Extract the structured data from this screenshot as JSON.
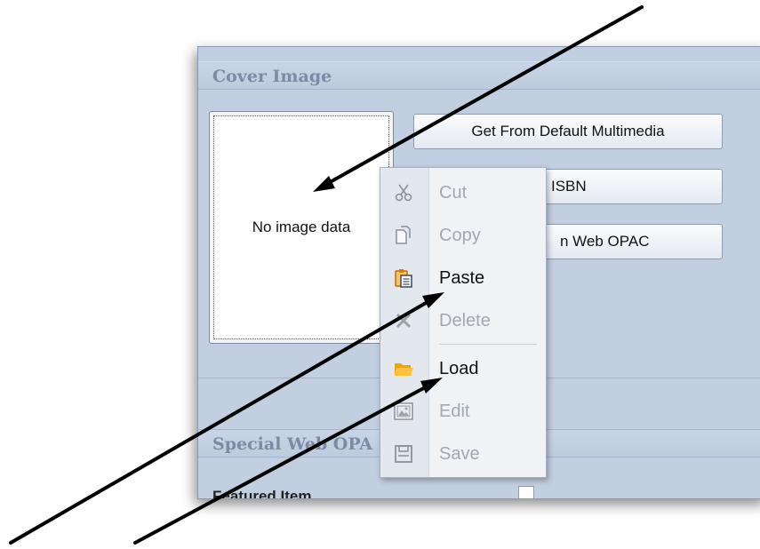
{
  "cover_group": {
    "title": "Cover Image",
    "placeholder": "No image data",
    "buttons": [
      "Get From Default Multimedia",
      "rom ISBN",
      "n Web OPAC"
    ]
  },
  "special_group": {
    "title": "Special Web OPA",
    "featured_label": "Featured Item"
  },
  "context_menu": {
    "items": [
      {
        "label": "Cut",
        "icon": "scissors-icon",
        "enabled": false
      },
      {
        "label": "Copy",
        "icon": "copy-icon",
        "enabled": false
      },
      {
        "label": "Paste",
        "icon": "paste-icon",
        "enabled": true
      },
      {
        "label": "Delete",
        "icon": "delete-icon",
        "enabled": false
      },
      {
        "label": "Load",
        "icon": "folder-icon",
        "enabled": true
      },
      {
        "label": "Edit",
        "icon": "edit-image-icon",
        "enabled": false
      },
      {
        "label": "Save",
        "icon": "save-icon",
        "enabled": false
      }
    ]
  },
  "colors": {
    "panel": "#c2cfe0",
    "group_title": "#7a8ba6",
    "menu_bg": "#f0f2f6",
    "disabled_text": "#a2a8b3",
    "folder": "#f2a300",
    "paste_orange": "#e07b00",
    "annotation_arrow": "#000000"
  }
}
